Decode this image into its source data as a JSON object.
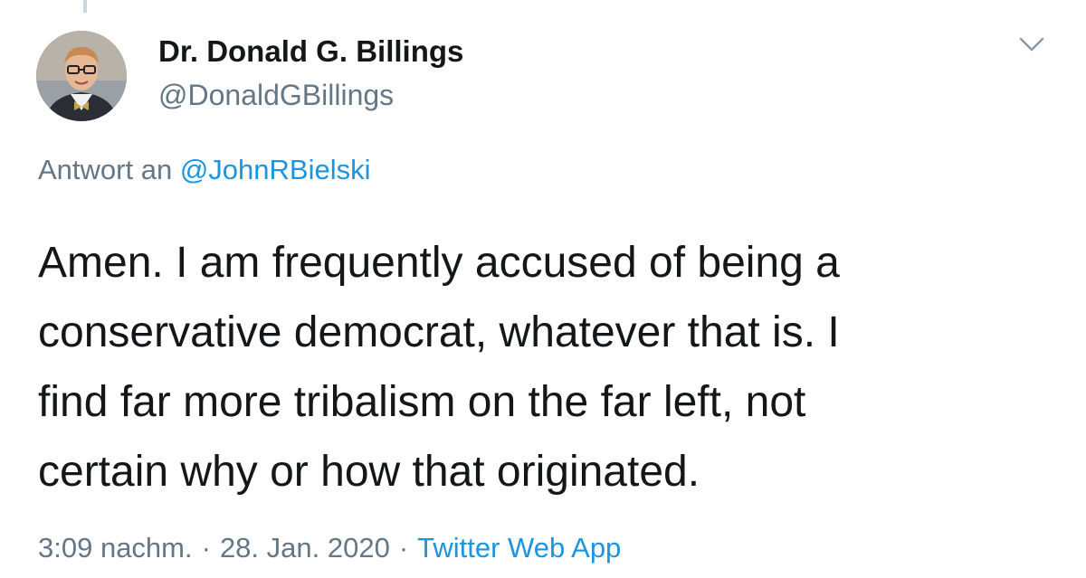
{
  "tweet": {
    "author_name": "Dr. Donald G. Billings",
    "author_handle": "@DonaldGBillings",
    "reply_prefix": "Antwort an",
    "reply_to": "@JohnRBielski",
    "text": "Amen.  I am frequently accused of being a\nconservative democrat, whatever that is.  I\nfind far more tribalism on the far left, not\ncertain why or how that originated.",
    "time": "3:09 nachm.",
    "separator": "·",
    "date": "28. Jan. 2020",
    "source_app": "Twitter Web App"
  },
  "icons": {
    "menu_caret": "chevron-down-icon",
    "avatar": "profile-photo"
  },
  "colors": {
    "text_primary": "#14171a",
    "text_secondary": "#657786",
    "link": "#1b95e0",
    "thread_line": "#ccd6dd"
  }
}
